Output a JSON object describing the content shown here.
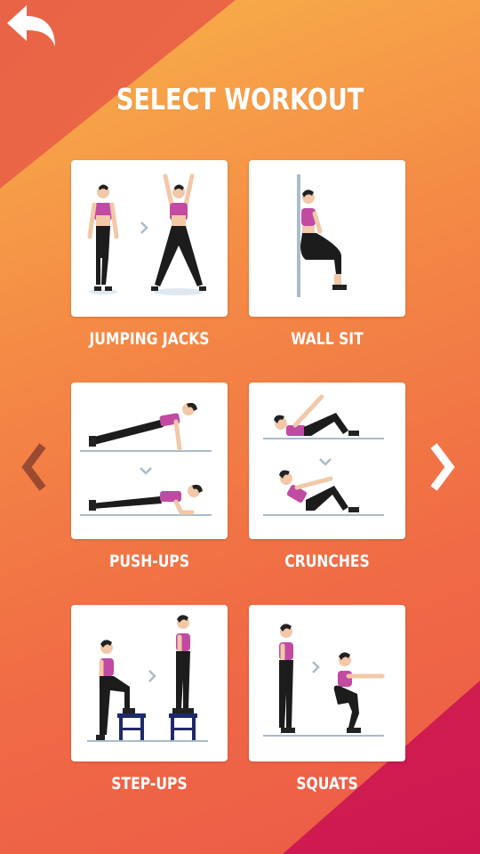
{
  "header": {
    "title": "SELECT WORKOUT",
    "back_icon": "back-arrow-icon"
  },
  "workouts": [
    {
      "label": "JUMPING JACKS",
      "icon": "jumping-jacks-illustration"
    },
    {
      "label": "WALL SIT",
      "icon": "wall-sit-illustration"
    },
    {
      "label": "PUSH-UPS",
      "icon": "push-ups-illustration"
    },
    {
      "label": "CRUNCHES",
      "icon": "crunches-illustration"
    },
    {
      "label": "STEP-UPS",
      "icon": "step-ups-illustration"
    },
    {
      "label": "SQUATS",
      "icon": "squats-illustration"
    }
  ],
  "navigation": {
    "prev_icon": "chevron-left-icon",
    "next_icon": "chevron-right-icon"
  },
  "colors": {
    "accent_pink": "#c24aa3",
    "legging_black": "#1c1c1c",
    "skin": "#f2c8a8",
    "floor_line": "#a9bccb",
    "bench": "#1f2a6b",
    "prev_chevron": "#9b4a32",
    "next_chevron": "#ffffff"
  }
}
